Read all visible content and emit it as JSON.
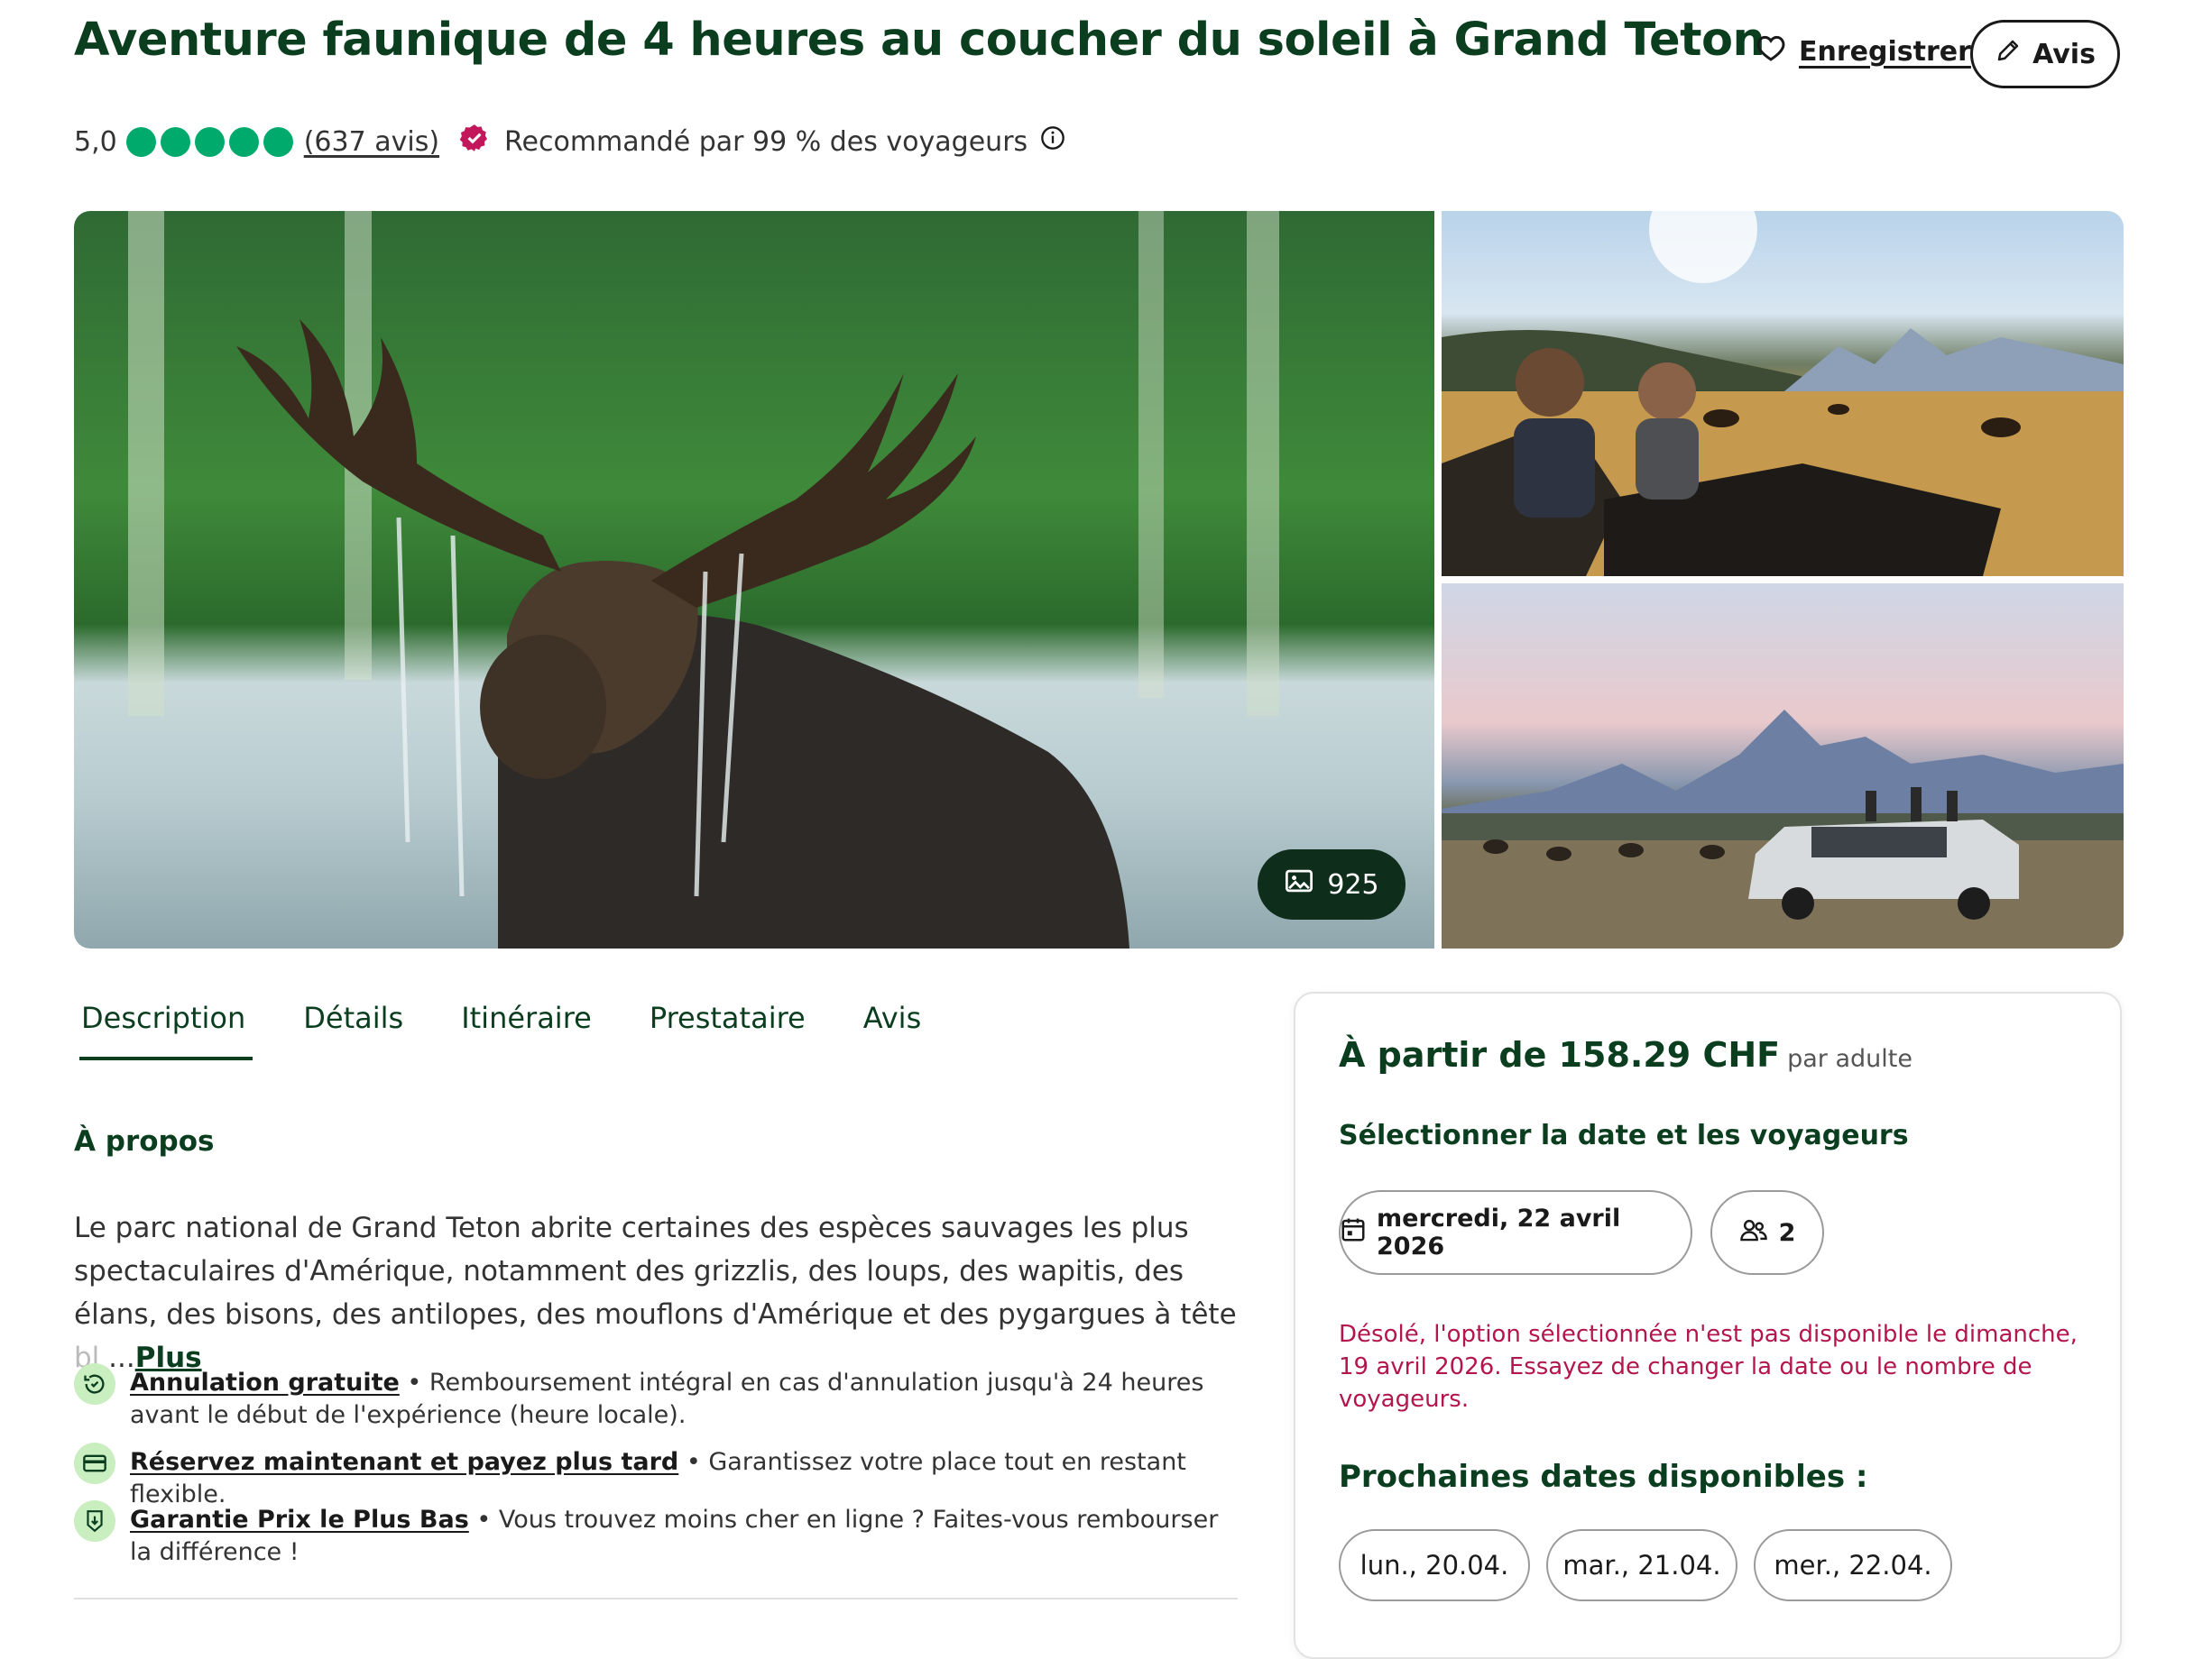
{
  "header": {
    "title": "Aventure faunique de 4 heures au coucher du soleil à Grand Teton",
    "save_label": "Enregistrer",
    "review_label": "Avis"
  },
  "rating": {
    "score": "5,0",
    "bubbles": 5,
    "reviews_count": "(637 avis)",
    "recommended": "Recommandé par 99 % des voyageurs"
  },
  "gallery": {
    "photo_count": "925"
  },
  "tabs": [
    {
      "label": "Description"
    },
    {
      "label": "Détails"
    },
    {
      "label": "Itinéraire"
    },
    {
      "label": "Prestataire"
    },
    {
      "label": "Avis"
    }
  ],
  "about": {
    "heading": "À propos",
    "text_main": "Le parc national de Grand Teton abrite certaines des espèces sauvages les plus spectaculaires d'Amérique, notamment des grizzlis, des loups, des wapitis, des élans, des bisons, des antilopes, des mouflons d'Amérique et des pygargues à tête ",
    "text_fade": "bl",
    "more_label": "Plus"
  },
  "features": [
    {
      "link": "Annulation gratuite",
      "text": " • Remboursement intégral en cas d'annulation jusqu'à 24 heures avant le début de l'expérience (heure locale)."
    },
    {
      "link": "Réservez maintenant et payez plus tard",
      "text": " • Garantissez votre place tout en restant flexible."
    },
    {
      "link": "Garantie Prix le Plus Bas",
      "text": " • Vous trouvez moins cher en ligne ? Faites-vous rembourser la différence !"
    }
  ],
  "booking": {
    "price": "À partir de 158.29 CHF",
    "unit": "par adulte",
    "select_heading": "Sélectionner la date et les voyageurs",
    "date_value": "mercredi, 22 avril 2026",
    "travelers_value": "2",
    "error": "Désolé, l'option sélectionnée n'est pas disponible le dimanche, 19 avril 2026. Essayez de changer la date ou le nombre de voyageurs.",
    "next_heading": "Prochaines dates disponibles :",
    "next_dates": [
      "lun., 20.04.",
      "mar., 21.04.",
      "mer., 22.04."
    ]
  },
  "colors": {
    "brand_green": "#0b3d1f",
    "rating_green": "#00aa6c",
    "error_red": "#b2164c",
    "badge_pink": "#c2185b"
  }
}
